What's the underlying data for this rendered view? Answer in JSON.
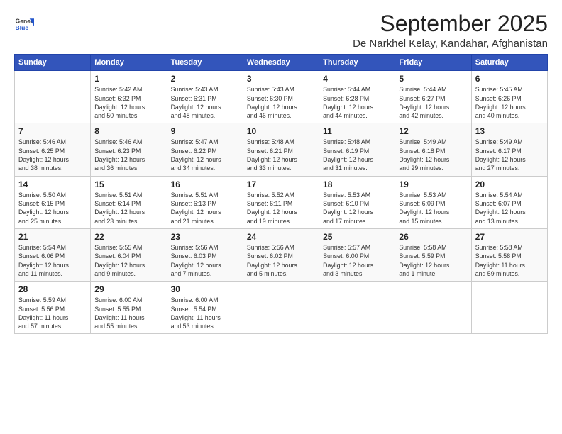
{
  "logo": {
    "line1": "General",
    "line2": "Blue"
  },
  "title": "September 2025",
  "location": "De Narkhel Kelay, Kandahar, Afghanistan",
  "days_header": [
    "Sunday",
    "Monday",
    "Tuesday",
    "Wednesday",
    "Thursday",
    "Friday",
    "Saturday"
  ],
  "weeks": [
    [
      {
        "day": "",
        "info": ""
      },
      {
        "day": "1",
        "info": "Sunrise: 5:42 AM\nSunset: 6:32 PM\nDaylight: 12 hours\nand 50 minutes."
      },
      {
        "day": "2",
        "info": "Sunrise: 5:43 AM\nSunset: 6:31 PM\nDaylight: 12 hours\nand 48 minutes."
      },
      {
        "day": "3",
        "info": "Sunrise: 5:43 AM\nSunset: 6:30 PM\nDaylight: 12 hours\nand 46 minutes."
      },
      {
        "day": "4",
        "info": "Sunrise: 5:44 AM\nSunset: 6:28 PM\nDaylight: 12 hours\nand 44 minutes."
      },
      {
        "day": "5",
        "info": "Sunrise: 5:44 AM\nSunset: 6:27 PM\nDaylight: 12 hours\nand 42 minutes."
      },
      {
        "day": "6",
        "info": "Sunrise: 5:45 AM\nSunset: 6:26 PM\nDaylight: 12 hours\nand 40 minutes."
      }
    ],
    [
      {
        "day": "7",
        "info": "Sunrise: 5:46 AM\nSunset: 6:25 PM\nDaylight: 12 hours\nand 38 minutes."
      },
      {
        "day": "8",
        "info": "Sunrise: 5:46 AM\nSunset: 6:23 PM\nDaylight: 12 hours\nand 36 minutes."
      },
      {
        "day": "9",
        "info": "Sunrise: 5:47 AM\nSunset: 6:22 PM\nDaylight: 12 hours\nand 34 minutes."
      },
      {
        "day": "10",
        "info": "Sunrise: 5:48 AM\nSunset: 6:21 PM\nDaylight: 12 hours\nand 33 minutes."
      },
      {
        "day": "11",
        "info": "Sunrise: 5:48 AM\nSunset: 6:19 PM\nDaylight: 12 hours\nand 31 minutes."
      },
      {
        "day": "12",
        "info": "Sunrise: 5:49 AM\nSunset: 6:18 PM\nDaylight: 12 hours\nand 29 minutes."
      },
      {
        "day": "13",
        "info": "Sunrise: 5:49 AM\nSunset: 6:17 PM\nDaylight: 12 hours\nand 27 minutes."
      }
    ],
    [
      {
        "day": "14",
        "info": "Sunrise: 5:50 AM\nSunset: 6:15 PM\nDaylight: 12 hours\nand 25 minutes."
      },
      {
        "day": "15",
        "info": "Sunrise: 5:51 AM\nSunset: 6:14 PM\nDaylight: 12 hours\nand 23 minutes."
      },
      {
        "day": "16",
        "info": "Sunrise: 5:51 AM\nSunset: 6:13 PM\nDaylight: 12 hours\nand 21 minutes."
      },
      {
        "day": "17",
        "info": "Sunrise: 5:52 AM\nSunset: 6:11 PM\nDaylight: 12 hours\nand 19 minutes."
      },
      {
        "day": "18",
        "info": "Sunrise: 5:53 AM\nSunset: 6:10 PM\nDaylight: 12 hours\nand 17 minutes."
      },
      {
        "day": "19",
        "info": "Sunrise: 5:53 AM\nSunset: 6:09 PM\nDaylight: 12 hours\nand 15 minutes."
      },
      {
        "day": "20",
        "info": "Sunrise: 5:54 AM\nSunset: 6:07 PM\nDaylight: 12 hours\nand 13 minutes."
      }
    ],
    [
      {
        "day": "21",
        "info": "Sunrise: 5:54 AM\nSunset: 6:06 PM\nDaylight: 12 hours\nand 11 minutes."
      },
      {
        "day": "22",
        "info": "Sunrise: 5:55 AM\nSunset: 6:04 PM\nDaylight: 12 hours\nand 9 minutes."
      },
      {
        "day": "23",
        "info": "Sunrise: 5:56 AM\nSunset: 6:03 PM\nDaylight: 12 hours\nand 7 minutes."
      },
      {
        "day": "24",
        "info": "Sunrise: 5:56 AM\nSunset: 6:02 PM\nDaylight: 12 hours\nand 5 minutes."
      },
      {
        "day": "25",
        "info": "Sunrise: 5:57 AM\nSunset: 6:00 PM\nDaylight: 12 hours\nand 3 minutes."
      },
      {
        "day": "26",
        "info": "Sunrise: 5:58 AM\nSunset: 5:59 PM\nDaylight: 12 hours\nand 1 minute."
      },
      {
        "day": "27",
        "info": "Sunrise: 5:58 AM\nSunset: 5:58 PM\nDaylight: 11 hours\nand 59 minutes."
      }
    ],
    [
      {
        "day": "28",
        "info": "Sunrise: 5:59 AM\nSunset: 5:56 PM\nDaylight: 11 hours\nand 57 minutes."
      },
      {
        "day": "29",
        "info": "Sunrise: 6:00 AM\nSunset: 5:55 PM\nDaylight: 11 hours\nand 55 minutes."
      },
      {
        "day": "30",
        "info": "Sunrise: 6:00 AM\nSunset: 5:54 PM\nDaylight: 11 hours\nand 53 minutes."
      },
      {
        "day": "",
        "info": ""
      },
      {
        "day": "",
        "info": ""
      },
      {
        "day": "",
        "info": ""
      },
      {
        "day": "",
        "info": ""
      }
    ]
  ]
}
